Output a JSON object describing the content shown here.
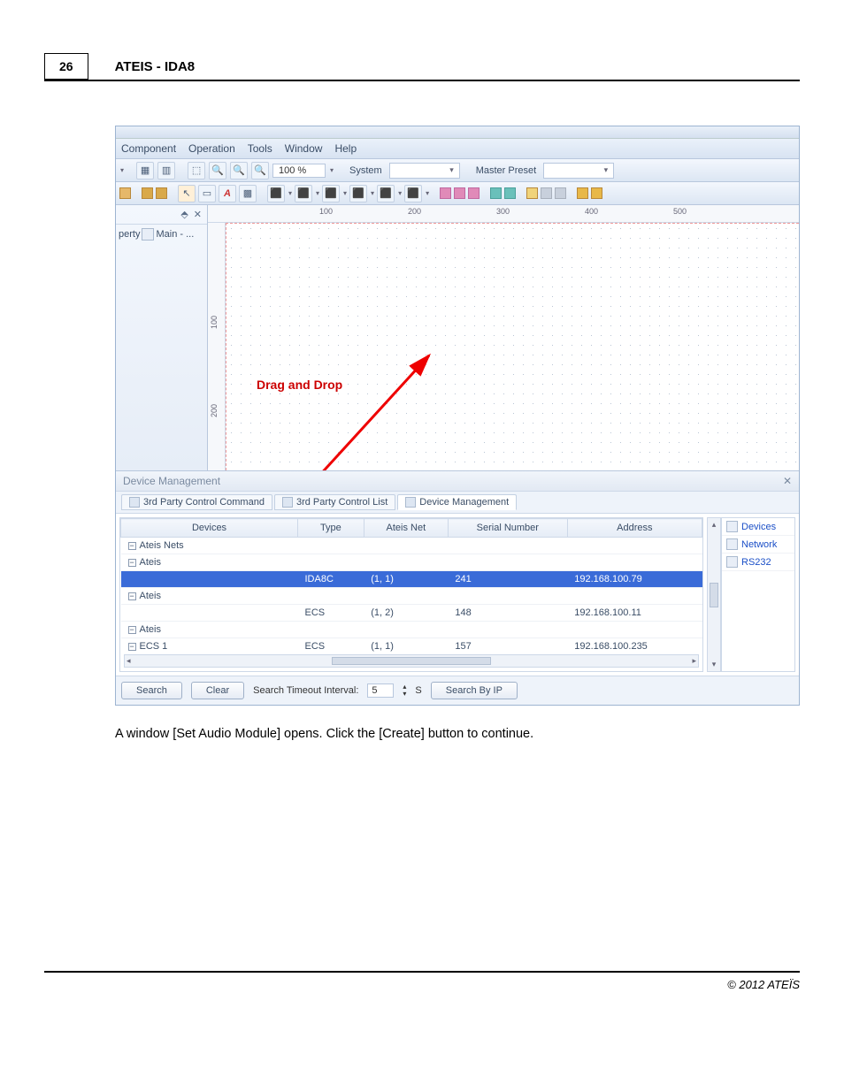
{
  "doc": {
    "page_number": "26",
    "title": "ATEIS - IDA8",
    "caption": "A window [Set Audio Module] opens. Click the [Create] button to continue.",
    "copyright": "© 2012 ATEÏS"
  },
  "menubar": [
    "Component",
    "Operation",
    "Tools",
    "Window",
    "Help"
  ],
  "toolbar": {
    "zoom": "100 %",
    "system_label": "System",
    "system_value": "",
    "preset_label": "Master Preset",
    "preset_value": ""
  },
  "side": {
    "pin": "⬘",
    "close": "✕",
    "tab1": "perty",
    "tab2": "Main - ..."
  },
  "ruler": {
    "h": [
      "100",
      "200",
      "300",
      "400",
      "500"
    ],
    "v": [
      "100",
      "200"
    ]
  },
  "annotation": "Drag and Drop",
  "dm": {
    "title": "Device Management",
    "tabs": [
      "3rd Party Control Command",
      "3rd Party Control List",
      "Device Management"
    ],
    "active_tab": 2,
    "columns": [
      "Devices",
      "Type",
      "Ateis Net",
      "Serial Number",
      "Address"
    ],
    "tree_root": "Ateis Nets",
    "rows": [
      {
        "tree": "Ateis",
        "indent": 1,
        "type": "",
        "net": "",
        "sn": "",
        "addr": "",
        "sel": false
      },
      {
        "tree": "",
        "indent": 2,
        "type": "IDA8C",
        "net": "(1, 1)",
        "sn": "241",
        "addr": "192.168.100.79",
        "sel": true
      },
      {
        "tree": "Ateis",
        "indent": 1,
        "type": "",
        "net": "",
        "sn": "",
        "addr": "",
        "sel": false
      },
      {
        "tree": "",
        "indent": 2,
        "type": "ECS",
        "net": "(1, 2)",
        "sn": "148",
        "addr": "192.168.100.11",
        "sel": false
      },
      {
        "tree": "Ateis",
        "indent": 1,
        "type": "",
        "net": "",
        "sn": "",
        "addr": "",
        "sel": false
      },
      {
        "tree": "ECS 1",
        "indent": 2,
        "type": "ECS",
        "net": "(1, 1)",
        "sn": "157",
        "addr": "192.168.100.235",
        "sel": false
      }
    ],
    "sidelist": [
      "Devices",
      "Network",
      "RS232"
    ],
    "search_btn": "Search",
    "clear_btn": "Clear",
    "timeout_label": "Search Timeout Interval:",
    "timeout_val": "5",
    "timeout_unit": "S",
    "searchip_btn": "Search By IP"
  }
}
